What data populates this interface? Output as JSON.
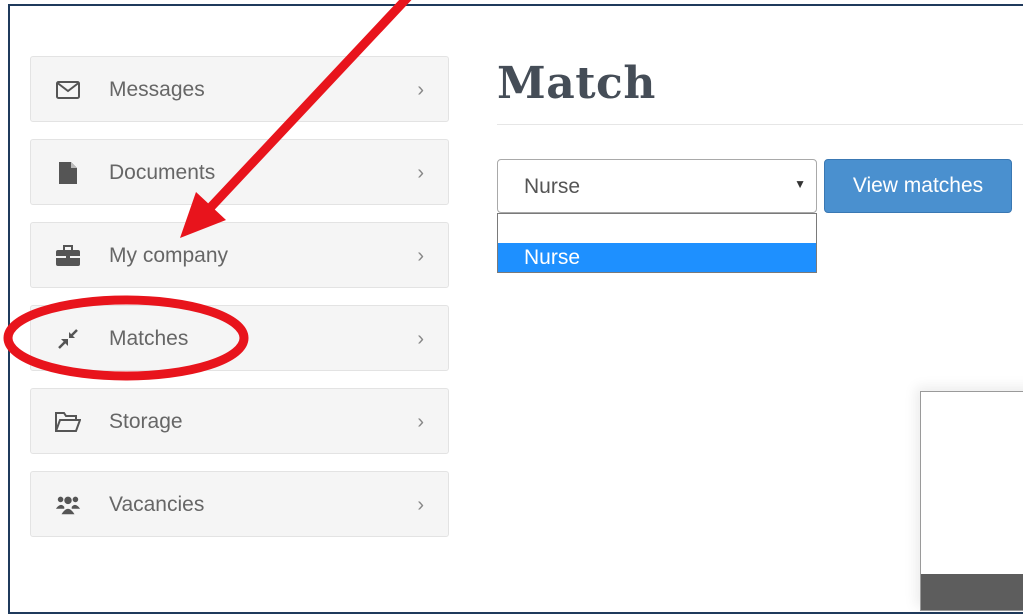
{
  "sidebar": {
    "items": [
      {
        "label": "Messages",
        "icon": "envelope-icon"
      },
      {
        "label": "Documents",
        "icon": "document-icon"
      },
      {
        "label": "My company",
        "icon": "briefcase-icon"
      },
      {
        "label": "Matches",
        "icon": "compress-arrows-icon"
      },
      {
        "label": "Storage",
        "icon": "folder-open-icon"
      },
      {
        "label": "Vacancies",
        "icon": "users-icon"
      }
    ],
    "chevron": "›"
  },
  "main": {
    "title": "Match",
    "select": {
      "value": "Nurse",
      "options": [
        "",
        "Nurse"
      ],
      "highlighted_option": "Nurse"
    },
    "view_button_label": "View matches"
  },
  "colors": {
    "annotation": "#e8141c",
    "primary_button": "#4a90cf",
    "dropdown_highlight": "#1e90ff",
    "frame_border": "#1f3a5c"
  }
}
